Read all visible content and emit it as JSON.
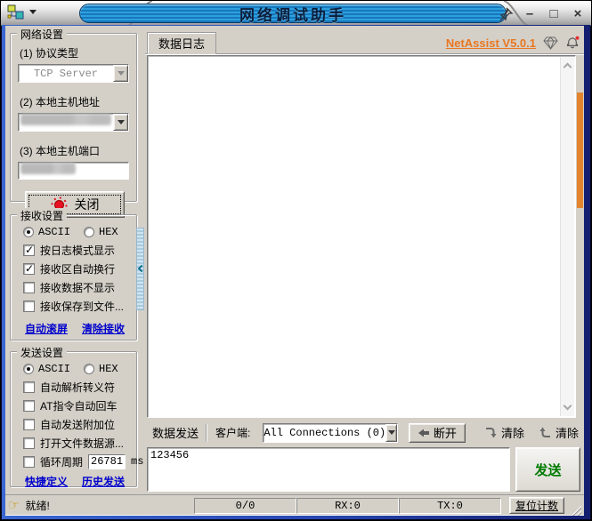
{
  "window": {
    "title": "网络调试助手"
  },
  "left_panel": {
    "network": {
      "title": "网络设置",
      "protocol_label": "(1) 协议类型",
      "protocol_value": "TCP Server",
      "address_label": "(2) 本地主机地址",
      "port_label": "(3) 本地主机端口",
      "close_button": "关闭"
    },
    "receive": {
      "title": "接收设置",
      "ascii_label": "ASCII",
      "hex_label": "HEX",
      "ascii_selected": true,
      "options": [
        {
          "label": "按日志模式显示",
          "checked": true
        },
        {
          "label": "接收区自动换行",
          "checked": true
        },
        {
          "label": "接收数据不显示",
          "checked": false
        },
        {
          "label": "接收保存到文件...",
          "checked": false
        }
      ],
      "link_autoscroll": "自动滚屏",
      "link_clear": "清除接收"
    },
    "send": {
      "title": "发送设置",
      "ascii_label": "ASCII",
      "hex_label": "HEX",
      "ascii_selected": true,
      "options": [
        {
          "label": "自动解析转义符",
          "checked": false
        },
        {
          "label": "AT指令自动回车",
          "checked": false
        },
        {
          "label": "自动发送附加位",
          "checked": false
        },
        {
          "label": "打开文件数据源...",
          "checked": false
        },
        {
          "label": "循环周期",
          "checked": false
        }
      ],
      "cycle_value": "26781",
      "cycle_unit": "ms",
      "link_shortcut": "快捷定义",
      "link_history": "历史发送"
    }
  },
  "main": {
    "log_tab": "数据日志",
    "version_link": "NetAssist V5.0.1",
    "log_content": "",
    "send_tab": "数据发送",
    "client_label": "客户端:",
    "client_value": "All Connections (0)",
    "disconnect_button": "断开",
    "clear_receive_button": "清除",
    "clear_send_button": "清除",
    "send_text": "123456",
    "send_button": "发送"
  },
  "statusbar": {
    "status_text": "就绪!",
    "connection_count": "0/0",
    "rx_count": "RX:0",
    "tx_count": "TX:0",
    "reset_button": "复位计数"
  },
  "colors": {
    "accent_orange": "#e87722",
    "link_blue": "#0000cc",
    "send_green": "#007a00",
    "title_blue": "#1f8fd0"
  }
}
